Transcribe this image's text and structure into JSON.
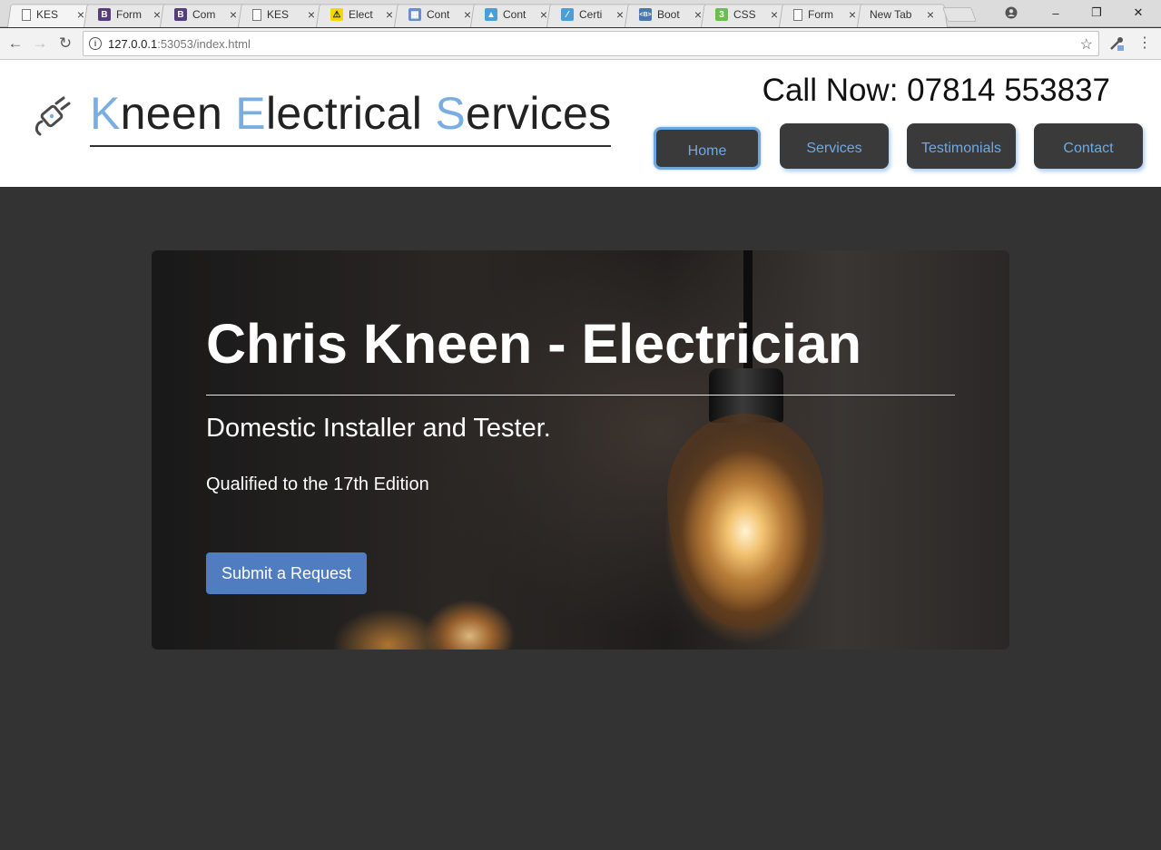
{
  "browser": {
    "tabs": [
      {
        "title": "KES",
        "icon": "page-icon"
      },
      {
        "title": "Form",
        "icon": "bootstrap-icon"
      },
      {
        "title": "Com",
        "icon": "bootstrap-icon"
      },
      {
        "title": "KES",
        "icon": "page-icon"
      },
      {
        "title": "Elect",
        "icon": "yell-icon"
      },
      {
        "title": "Cont",
        "icon": "grid-icon"
      },
      {
        "title": "Cont",
        "icon": "triangle-icon"
      },
      {
        "title": "Certi",
        "icon": "slash-icon"
      },
      {
        "title": "Boot",
        "icon": "boot-icon"
      },
      {
        "title": "CSS",
        "icon": "css3-icon"
      },
      {
        "title": "Form",
        "icon": "page-icon"
      },
      {
        "title": "New Tab",
        "icon": ""
      }
    ],
    "tab_icon_text": {
      "bootstrap": "B",
      "css": "3",
      "boot": "<B>"
    },
    "url_host": "127.0.0.1",
    "url_rest": ":53053/index.html",
    "controls": {
      "minimize": "–",
      "restore": "❐",
      "close": "✕"
    }
  },
  "site": {
    "title_parts": [
      {
        "text": "K",
        "accent": true
      },
      {
        "text": "neen ",
        "accent": false
      },
      {
        "text": "E",
        "accent": true
      },
      {
        "text": "lectrical ",
        "accent": false
      },
      {
        "text": "S",
        "accent": true
      },
      {
        "text": "ervices",
        "accent": false
      }
    ],
    "call_now": "Call Now: 07814 553837",
    "nav": [
      {
        "label": "Home",
        "active": true
      },
      {
        "label": "Services",
        "active": false
      },
      {
        "label": "Testimonials",
        "active": false
      },
      {
        "label": "Contact",
        "active": false
      }
    ]
  },
  "hero": {
    "title": "Chris Kneen - Electrician",
    "subtitle": "Domestic Installer and Tester.",
    "qualification": "Qualified to the 17th Edition",
    "button": "Submit a Request"
  },
  "colors": {
    "accent": "#7aaee0",
    "nav_bg": "#3a3a3a",
    "nav_text": "#6fa8e6",
    "button_blue": "#4f7dbf",
    "page_bg": "#333333"
  }
}
